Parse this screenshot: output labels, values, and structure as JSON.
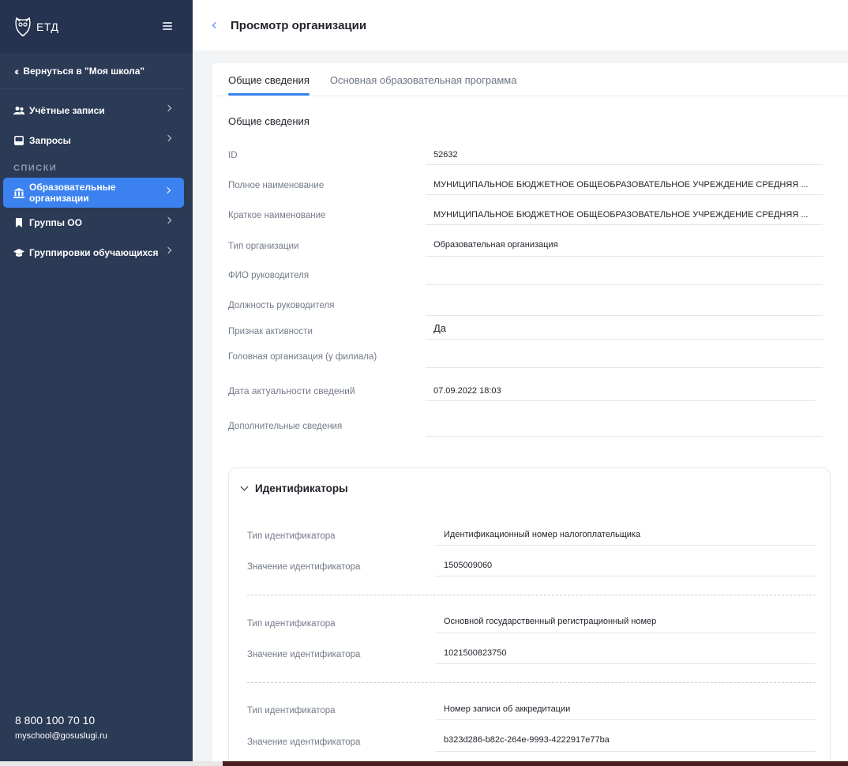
{
  "sidebar": {
    "logo_text": "ЕТД",
    "back_label": "Вернуться в \"Моя школа\"",
    "items": [
      {
        "label": "Учётные записи"
      },
      {
        "label": "Запросы"
      }
    ],
    "section_label": "СПИСКИ",
    "list_items": [
      {
        "label": "Образовательные организации"
      },
      {
        "label": "Группы ОО"
      },
      {
        "label": "Группировки обучающихся"
      }
    ],
    "phone": "8 800 100 70 10",
    "email": "myschool@gosuslugi.ru"
  },
  "header": {
    "title": "Просмотр организации"
  },
  "tabs": [
    {
      "label": "Общие сведения"
    },
    {
      "label": "Основная образовательная программа"
    }
  ],
  "general": {
    "title": "Общие сведения",
    "fields": [
      {
        "label": "ID",
        "value": "52632"
      },
      {
        "label": "Полное наименование",
        "value": "МУНИЦИПАЛЬНОЕ БЮДЖЕТНОЕ ОБЩЕОБРАЗОВАТЕЛЬНОЕ УЧРЕЖДЕНИЕ СРЕДНЯЯ ..."
      },
      {
        "label": "Краткое наименование",
        "value": "МУНИЦИПАЛЬНОЕ БЮДЖЕТНОЕ ОБЩЕОБРАЗОВАТЕЛЬНОЕ УЧРЕЖДЕНИЕ СРЕДНЯЯ ..."
      },
      {
        "label": "Тип организации",
        "value": "Образовательная организация"
      },
      {
        "label": "ФИО руководителя",
        "value": ""
      },
      {
        "label": "Должность руководителя",
        "value": ""
      },
      {
        "label": "Признак активности",
        "value": "Да"
      },
      {
        "label": "Головная организация (у филиала)",
        "value": ""
      },
      {
        "label": "Дата актуальности сведений",
        "value": "07.09.2022 18:03"
      },
      {
        "label": "Дополнительные сведения",
        "value": ""
      }
    ]
  },
  "identifiers": {
    "title": "Идентификаторы",
    "type_label": "Тип идентификатора",
    "value_label": "Значение идентификатора",
    "items": [
      {
        "type": "Идентификационный номер налогоплательщика",
        "value": "1505009060"
      },
      {
        "type": "Основной государственный регистрационный номер",
        "value": "1021500823750"
      },
      {
        "type": "Номер записи об аккредитации",
        "value": "b323d286-b82c-264e-9993-4222917e77ba"
      }
    ]
  },
  "colors": {
    "sidebar": "#2b3a55",
    "accent": "#3b82f0"
  }
}
